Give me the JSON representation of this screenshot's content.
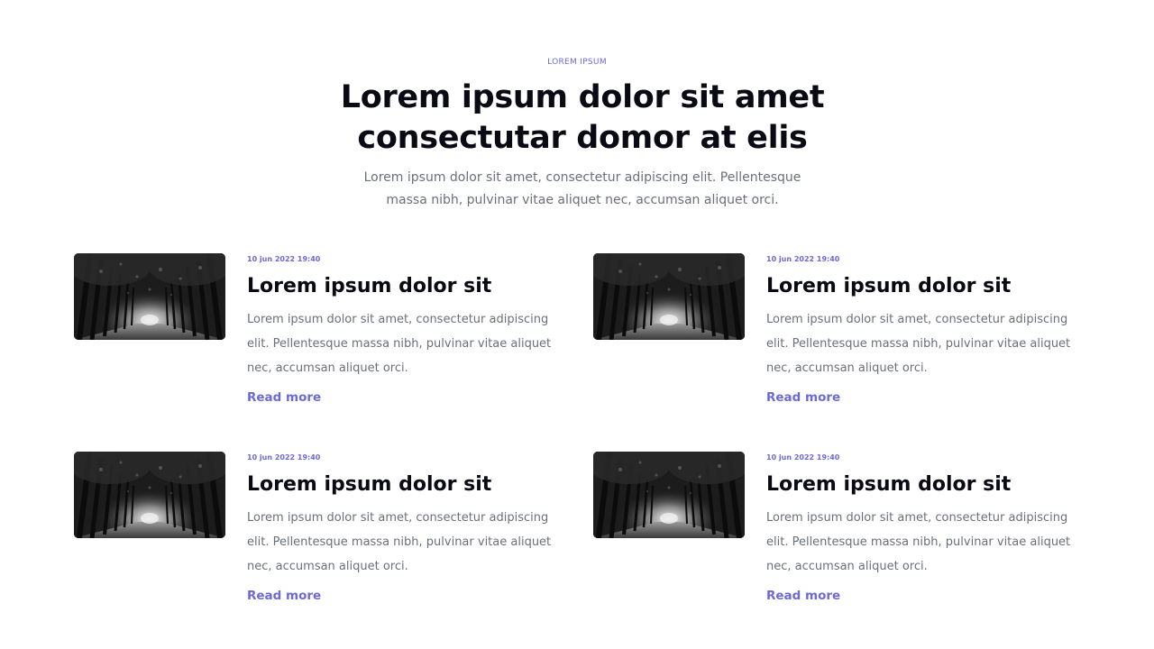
{
  "header": {
    "eyebrow": "LOREM IPSUM",
    "title": "Lorem ipsum dolor sit amet consectutar domor at elis",
    "subtitle": "Lorem ipsum dolor sit amet, consectetur adipiscing elit. Pellentesque massa nibh, pulvinar vitae aliquet nec, accumsan aliquet orci."
  },
  "colors": {
    "accent": "#6c6ad6",
    "heading": "#0a0a14",
    "body_text": "#6b6f7a"
  },
  "posts": [
    {
      "date": "10 jun 2022 19:40",
      "title": "Lorem ipsum dolor sit",
      "excerpt": "Lorem ipsum dolor sit amet, consectetur adipiscing elit. Pellentesque massa nibh, pulvinar vitae aliquet nec, accumsan aliquet orci.",
      "link": "Read more",
      "image": "tree-tunnel-photo"
    },
    {
      "date": "10 jun 2022 19:40",
      "title": "Lorem ipsum dolor sit",
      "excerpt": "Lorem ipsum dolor sit amet, consectetur adipiscing elit. Pellentesque massa nibh, pulvinar vitae aliquet nec, accumsan aliquet orci.",
      "link": "Read more",
      "image": "tree-tunnel-photo"
    },
    {
      "date": "10 jun 2022 19:40",
      "title": "Lorem ipsum dolor sit",
      "excerpt": "Lorem ipsum dolor sit amet, consectetur adipiscing elit. Pellentesque massa nibh, pulvinar vitae aliquet nec, accumsan aliquet orci.",
      "link": "Read more",
      "image": "tree-tunnel-photo"
    },
    {
      "date": "10 jun 2022 19:40",
      "title": "Lorem ipsum dolor sit",
      "excerpt": "Lorem ipsum dolor sit amet, consectetur adipiscing elit. Pellentesque massa nibh, pulvinar vitae aliquet nec, accumsan aliquet orci.",
      "link": "Read more",
      "image": "tree-tunnel-photo"
    }
  ]
}
